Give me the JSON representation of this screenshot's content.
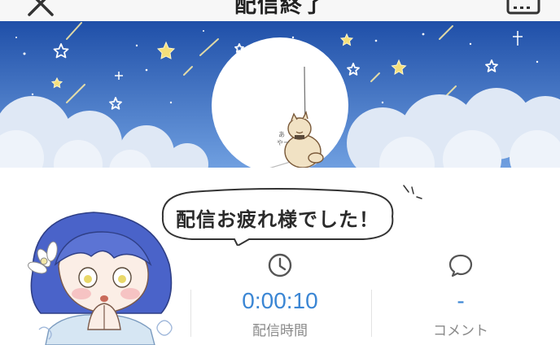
{
  "header": {
    "title": "配信終了",
    "close_icon": "close-icon",
    "keyboard_icon": "keyboard-icon"
  },
  "message": {
    "text": "配信お疲れ様でした！"
  },
  "stats": [
    {
      "icon": "clock-icon",
      "value": "0:00:10",
      "label": "配信時間"
    },
    {
      "icon": "comment-icon",
      "value": "-",
      "label": "コメント"
    }
  ],
  "colors": {
    "accent": "#3b86d4",
    "sky_top": "#1f4fa8",
    "sky_bottom": "#6f9fe0",
    "label": "#8a8a8a"
  }
}
